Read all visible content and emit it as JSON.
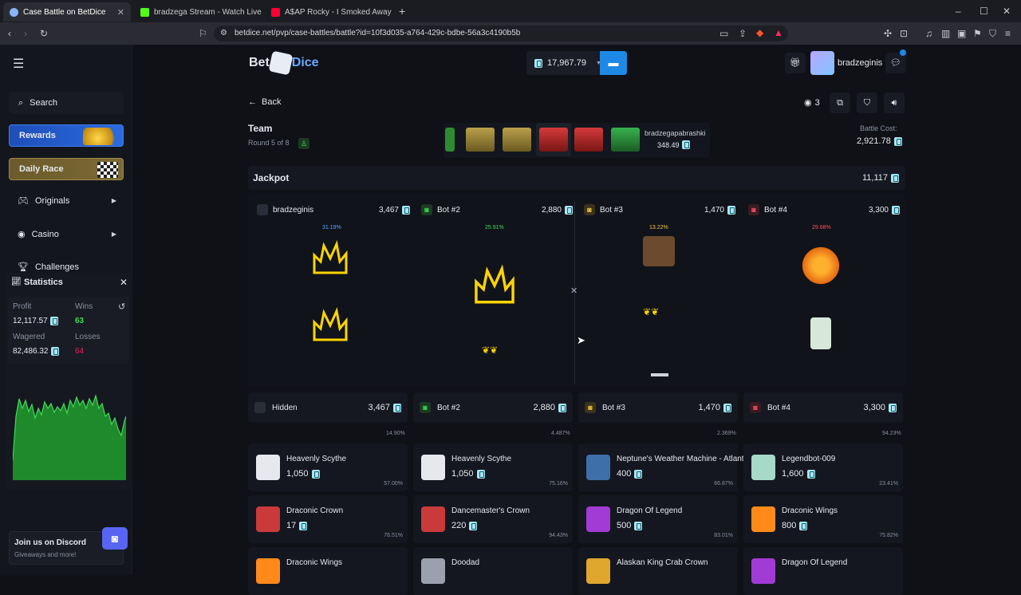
{
  "browser": {
    "tabs": [
      {
        "title": "Case Battle on BetDice",
        "active": true,
        "color": "#8ab4f8"
      },
      {
        "title": "bradzega Stream - Watch Live on Kick",
        "active": false,
        "color": "#53fc18"
      },
      {
        "title": "A$AP Rocky - I Smoked Away My",
        "active": false,
        "color": "#ff0033"
      }
    ],
    "url": "betdice.net/pvp/case-battles/battle?id=10f3d035-a764-429c-bdbe-56a3c4190b5b",
    "new_tab": "+"
  },
  "brand": {
    "logo_text_left": "Bet",
    "logo_text_right": "Dice"
  },
  "wallet": {
    "balance": "17,967.79"
  },
  "user": {
    "name": "bradzeginis"
  },
  "sidebar": {
    "search": "Search",
    "rewards": "Rewards",
    "daily_race": "Daily Race",
    "originals": "Originals",
    "casino": "Casino",
    "challenges": "Challenges",
    "discord_title": "Join us on Discord",
    "discord_sub": "Giveaways and more!"
  },
  "stats": {
    "title": "Statistics",
    "profit_label": "Profit",
    "profit": "12,117.57",
    "wins_label": "Wins",
    "wins": "63",
    "wagered_label": "Wagered",
    "wagered": "82,486.32",
    "losses_label": "Losses",
    "losses": "64"
  },
  "battle": {
    "back": "Back",
    "viewers": "3",
    "mode": "Team",
    "round": "Round 5 of 8",
    "current_case_owner": "bradzegapabrashki",
    "current_case_value": "348.49",
    "cost_label": "Battle Cost:",
    "cost": "2,921.78",
    "jackpot_label": "Jackpot",
    "jackpot": "11,117"
  },
  "players": [
    {
      "name": "bradzeginis",
      "value": "3,467",
      "pct": "31.19%",
      "pct_color": "#5aa9ff"
    },
    {
      "name": "Bot #2",
      "value": "2,880",
      "pct": "25.91%",
      "pct_color": "#3ddc57"
    },
    {
      "name": "Bot #3",
      "value": "1,470",
      "pct": "13.22%",
      "pct_color": "#f5c542"
    },
    {
      "name": "Bot #4",
      "value": "3,300",
      "pct": "29.68%",
      "pct_color": "#ff4d5e"
    }
  ],
  "summary": [
    {
      "name": "Hidden",
      "value": "3,467",
      "pct": "14.90%"
    },
    {
      "name": "Bot #2",
      "value": "2,880",
      "pct": "4.487%"
    },
    {
      "name": "Bot #3",
      "value": "1,470",
      "pct": "2.369%"
    },
    {
      "name": "Bot #4",
      "value": "3,300",
      "pct": "94.23%"
    }
  ],
  "items": [
    [
      {
        "name": "Heavenly Scythe",
        "price": "1,050",
        "pct": "57.00%",
        "icon": "scythe-icon"
      },
      {
        "name": "Draconic Crown",
        "price": "17",
        "pct": "76.51%",
        "icon": "crown-icon"
      },
      {
        "name": "Draconic Wings",
        "price": "",
        "pct": "",
        "icon": "wings-icon"
      }
    ],
    [
      {
        "name": "Heavenly Scythe",
        "price": "1,050",
        "pct": "75.16%",
        "icon": "scythe-icon"
      },
      {
        "name": "Dancemaster's Crown",
        "price": "220",
        "pct": "94.43%",
        "icon": "crown-icon"
      },
      {
        "name": "Doodad",
        "price": "",
        "pct": "",
        "icon": "doodad-icon"
      }
    ],
    [
      {
        "name": "Neptune's Weather Machine - Atlantis",
        "price": "400",
        "pct": "66.87%",
        "icon": "machine-icon"
      },
      {
        "name": "Dragon Of Legend",
        "price": "500",
        "pct": "83.01%",
        "icon": "dragon-icon"
      },
      {
        "name": "Alaskan King Crab Crown",
        "price": "",
        "pct": "",
        "icon": "crab-crown-icon"
      }
    ],
    [
      {
        "name": "Legendbot-009",
        "price": "1,600",
        "pct": "23.41%",
        "icon": "bot-icon"
      },
      {
        "name": "Draconic Wings",
        "price": "800",
        "pct": "75.82%",
        "icon": "wings-icon"
      },
      {
        "name": "Dragon Of Legend",
        "price": "",
        "pct": "",
        "icon": "dragon-icon"
      }
    ]
  ],
  "colors": {
    "accent": "#1e88e5",
    "win": "#3ddc57",
    "loss": "#e0245e",
    "gold": "#ffd400"
  }
}
